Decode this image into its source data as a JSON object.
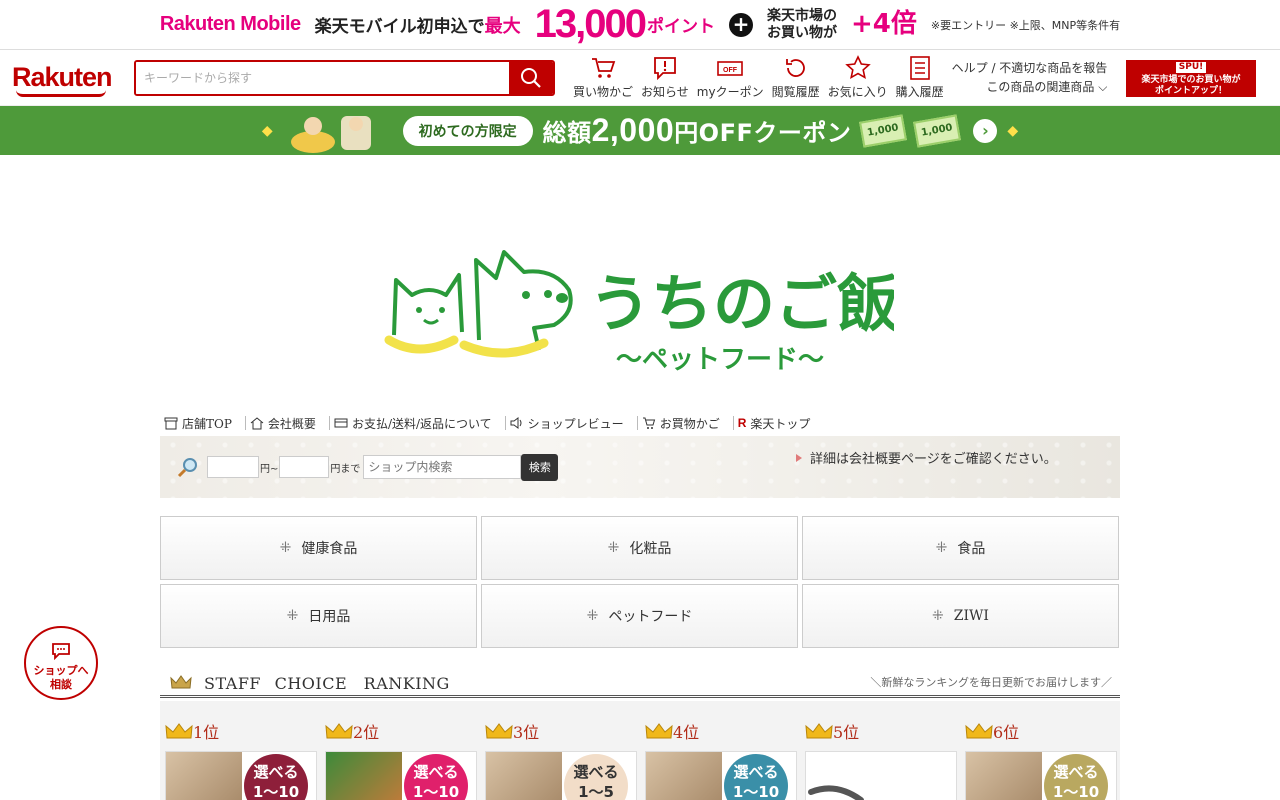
{
  "promo": {
    "brand": "Rakuten Mobile",
    "text1": "楽天モバイル初申込で",
    "max": "最大",
    "amount": "13,000",
    "points": "ポイント",
    "plus": "+",
    "text2a": "楽天市場の",
    "text2b": "お買い物が",
    "multiplier": "+4倍",
    "note": "※要エントリー ※上限、MNP等条件有"
  },
  "header": {
    "logo": "Rakuten",
    "search_placeholder": "キーワードから探す",
    "nav": [
      {
        "label": "買い物かご",
        "icon": "cart-icon"
      },
      {
        "label": "お知らせ",
        "icon": "notice-icon"
      },
      {
        "label": "myクーポン",
        "icon": "coupon-icon"
      },
      {
        "label": "閲覧履歴",
        "icon": "history-icon"
      },
      {
        "label": "お気に入り",
        "icon": "star-icon"
      },
      {
        "label": "購入履歴",
        "icon": "list-icon"
      }
    ],
    "help_link": "ヘルプ / 不適切な商品を報告",
    "related_link": "この商品の関連商品",
    "spu_line1": "SPU!",
    "spu_line2": "楽天市場でのお買い物が",
    "spu_line3": "ポイントアップ！"
  },
  "coupon": {
    "pill": "初めての方限定",
    "text": "総額",
    "amount": "2,000",
    "suffix": "円OFFクーポン",
    "bill": "1,000"
  },
  "shop": {
    "logo_title": "うちのご飯",
    "logo_sub": "〜ペットフード〜",
    "nav": [
      {
        "label": "店舗TOP",
        "icon": "store-icon"
      },
      {
        "label": "会社概要",
        "icon": "home-icon"
      },
      {
        "label": "お支払/送料/返品について",
        "icon": "card-icon"
      },
      {
        "label": "ショップレビュー",
        "icon": "speaker-icon"
      },
      {
        "label": "お買物かご",
        "icon": "cart-icon"
      },
      {
        "label": "楽天トップ",
        "icon": "rakuten-r-icon"
      }
    ],
    "price_unit_from": "円~",
    "price_unit_to": "円まで",
    "search_placeholder": "ショップ内検索",
    "search_button": "検索",
    "notice": "詳細は会社概要ページをご確認ください。"
  },
  "categories": [
    {
      "label": "健康食品"
    },
    {
      "label": "化粧品"
    },
    {
      "label": "食品"
    },
    {
      "label": "日用品"
    },
    {
      "label": "ペットフード"
    },
    {
      "label": "ZIWI"
    }
  ],
  "ranking": {
    "title": "STAFF CHOICE　RANKING",
    "subtitle": "＼新鮮なランキングを毎日更新でお届けします／",
    "items": [
      {
        "rank": "1位",
        "badge_top": "選べる",
        "badge_bottom": "1～10",
        "color": "#8e1f3a"
      },
      {
        "rank": "2位",
        "badge_top": "選べる",
        "badge_bottom": "1～10",
        "color": "#e0206b"
      },
      {
        "rank": "3位",
        "badge_top": "選べる",
        "badge_bottom": "1～5",
        "color": "#f2ddc8"
      },
      {
        "rank": "4位",
        "badge_top": "選べる",
        "badge_bottom": "1～10",
        "color": "#3a8fa8"
      },
      {
        "rank": "5位",
        "badge_top": "",
        "badge_bottom": "",
        "color": ""
      },
      {
        "rank": "6位",
        "badge_top": "選べる",
        "badge_bottom": "1～10",
        "color": "#b9a860"
      }
    ]
  },
  "consult": {
    "line1": "ショップへ",
    "line2": "相談"
  },
  "colors": {
    "rakuten_red": "#bf0000",
    "promo_pink": "#e6007e",
    "coupon_green": "#4e9a3a"
  }
}
